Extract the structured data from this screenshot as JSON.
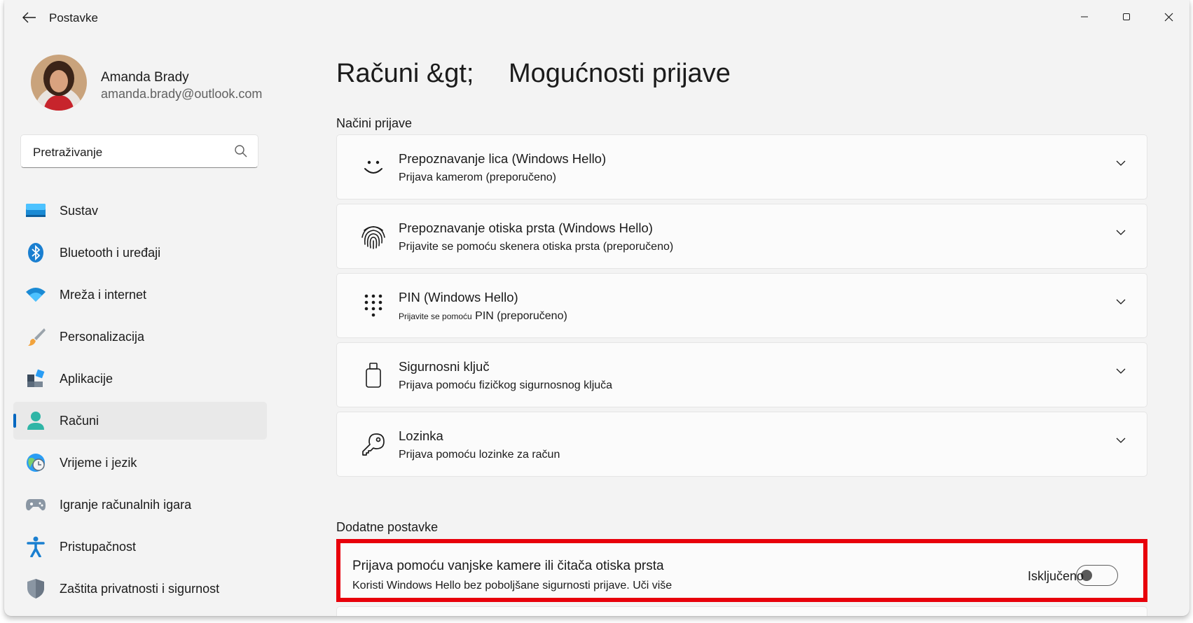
{
  "window": {
    "title": "Postavke"
  },
  "profile": {
    "name": "Amanda Brady",
    "email": "amanda.brady@outlook.com"
  },
  "search": {
    "placeholder": "Pretraživanje",
    "icon": "search-icon"
  },
  "sidebar": {
    "items": [
      {
        "label": "Sustav",
        "icon": "system-icon",
        "active": false
      },
      {
        "label": "Bluetooth i uređaji",
        "icon": "bluetooth-icon",
        "active": false
      },
      {
        "label": "Mreža i internet",
        "icon": "wifi-icon",
        "active": false
      },
      {
        "label": "Personalizacija",
        "icon": "brush-icon",
        "active": false
      },
      {
        "label": "Aplikacije",
        "icon": "apps-icon",
        "active": false
      },
      {
        "label": "Računi",
        "icon": "accounts-icon",
        "active": true
      },
      {
        "label": "Vrijeme i jezik",
        "icon": "time-language-icon",
        "active": false
      },
      {
        "label": "Igranje računalnih igara",
        "icon": "gaming-icon",
        "active": false
      },
      {
        "label": "Pristupačnost",
        "icon": "accessibility-icon",
        "active": false
      },
      {
        "label": "Zaštita privatnosti i sigurnost",
        "icon": "shield-icon",
        "active": false
      }
    ]
  },
  "main": {
    "breadcrumb": "Računi &gt;",
    "title": "Mogućnosti prijave",
    "section_signin": "Načini prijave",
    "options": [
      {
        "title": "Prepoznavanje lica (Windows Hello)",
        "subtitle": "Prijava kamerom (preporučeno)",
        "icon": "face-icon"
      },
      {
        "title": "Prepoznavanje otiska prsta (Windows Hello)",
        "subtitle": "Prijavite se pomoću skenera otiska prsta (preporučeno)",
        "icon": "fingerprint-icon"
      },
      {
        "title": "PIN (Windows Hello)",
        "subtitle_small": "Prijavite se pomoću",
        "subtitle": "PIN (preporučeno)",
        "icon": "pin-keypad-icon"
      },
      {
        "title": "Sigurnosni ključ",
        "subtitle": "Prijava pomoću fizičkog sigurnosnog ključa",
        "icon": "security-key-icon"
      },
      {
        "title": "Lozinka",
        "subtitle": "Prijava pomoću lozinke za račun",
        "icon": "key-icon"
      }
    ],
    "section_additional": "Dodatne postavke",
    "external": {
      "title": "Prijava pomoću vanjske kamere ili čitača otiska prsta",
      "subtitle": "Koristi Windows Hello bez poboljšane sigurnosti prijave. Uči više",
      "toggle_label": "Isključeno",
      "toggle_on": false
    }
  },
  "colors": {
    "accent": "#0067c0",
    "highlight": "#e8000b",
    "background": "#f3f3f3",
    "card": "#fbfbfb"
  }
}
